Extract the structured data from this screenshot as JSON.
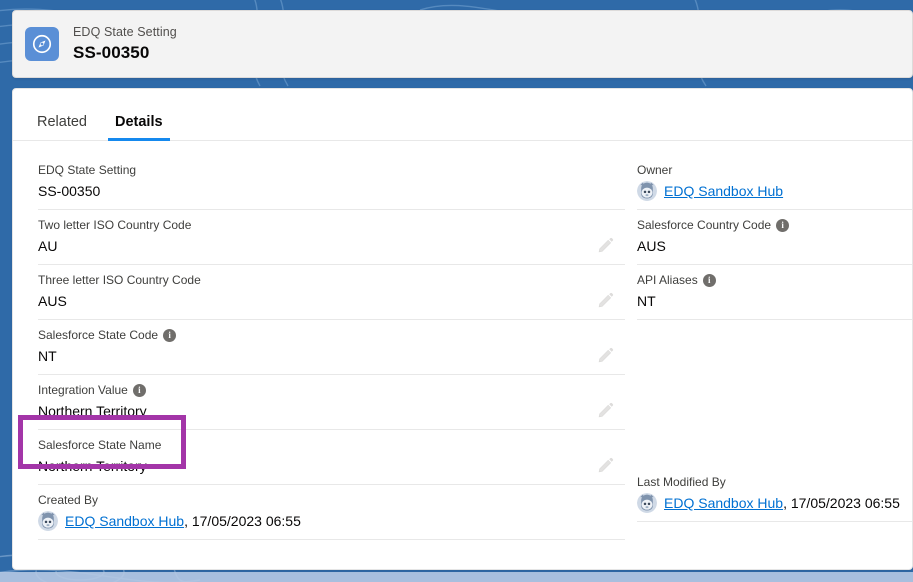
{
  "theme": {
    "background_blue": "#2f6aa8",
    "accent_blue": "#1589ee",
    "link_blue": "#0070d2",
    "highlight_purple": "#a335a8",
    "card_gray": "#f3f3f3"
  },
  "header": {
    "icon": "compass-icon",
    "object_label": "EDQ State Setting",
    "record_name": "SS-00350"
  },
  "tabs": [
    {
      "label": "Related",
      "active": false
    },
    {
      "label": "Details",
      "active": true
    }
  ],
  "details": {
    "left_column": [
      {
        "label": "EDQ State Setting",
        "value": "SS-00350",
        "has_info": false,
        "editable": false
      },
      {
        "label": "Two letter ISO Country Code",
        "value": "AU",
        "has_info": false,
        "editable": true
      },
      {
        "label": "Three letter ISO Country Code",
        "value": "AUS",
        "has_info": false,
        "editable": true
      },
      {
        "label": "Salesforce State Code",
        "value": "NT",
        "has_info": true,
        "editable": true
      },
      {
        "label": "Integration Value",
        "value": "Northern Territory",
        "has_info": true,
        "editable": true
      },
      {
        "label": "Salesforce State Name",
        "value": "Northern Territory",
        "has_info": false,
        "editable": true,
        "highlighted": true
      }
    ],
    "right_column": [
      {
        "label": "Owner",
        "value": "EDQ Sandbox Hub",
        "is_link": true,
        "has_avatar": true,
        "has_info": false
      },
      {
        "label": "Salesforce Country Code",
        "value": "AUS",
        "has_info": true
      },
      {
        "label": "API Aliases",
        "value": "NT",
        "has_info": true
      }
    ],
    "footer_left": {
      "label": "Created By",
      "user": "EDQ Sandbox Hub",
      "timestamp": ", 17/05/2023 06:55"
    },
    "footer_right": {
      "label": "Last Modified By",
      "user": "EDQ Sandbox Hub",
      "timestamp": ", 17/05/2023 06:55"
    }
  }
}
